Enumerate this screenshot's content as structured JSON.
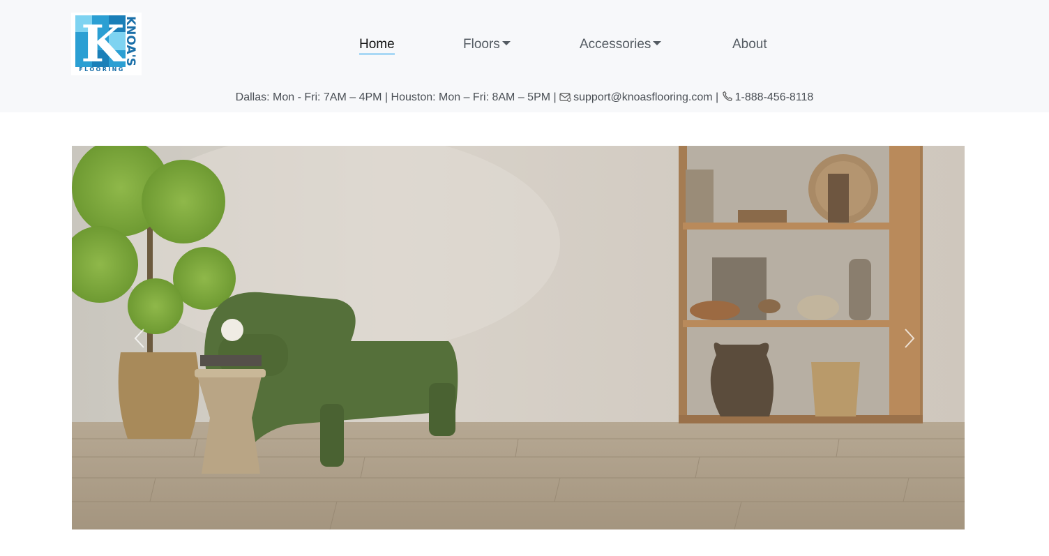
{
  "brand": {
    "logo_name": "KNOA'S",
    "logo_sub": "FLOORING",
    "logo_letter": "K",
    "colors": {
      "light_blue": "#7ed3f1",
      "blue": "#2b9fd3",
      "dark_blue": "#1a6fa8"
    }
  },
  "nav": {
    "items": [
      {
        "label": "Home",
        "active": true,
        "dropdown": false
      },
      {
        "label": "Floors",
        "active": false,
        "dropdown": true
      },
      {
        "label": "Accessories",
        "active": false,
        "dropdown": true
      },
      {
        "label": "About",
        "active": false,
        "dropdown": false
      }
    ]
  },
  "info": {
    "hours": "Dallas: Mon - Fri: 7AM – 4PM | Houston: Mon – Fri: 8AM – 5PM |",
    "email": "support@knoasflooring.com",
    "separator": "|",
    "phone": "1-888-456-8118",
    "email_icon": "envelope-icon",
    "phone_icon": "phone-icon"
  },
  "hero": {
    "prev_icon": "chevron-left-icon",
    "next_icon": "chevron-right-icon",
    "scene": "living room with green armchair, potted tree, wooden shelves and light wood plank floor"
  }
}
